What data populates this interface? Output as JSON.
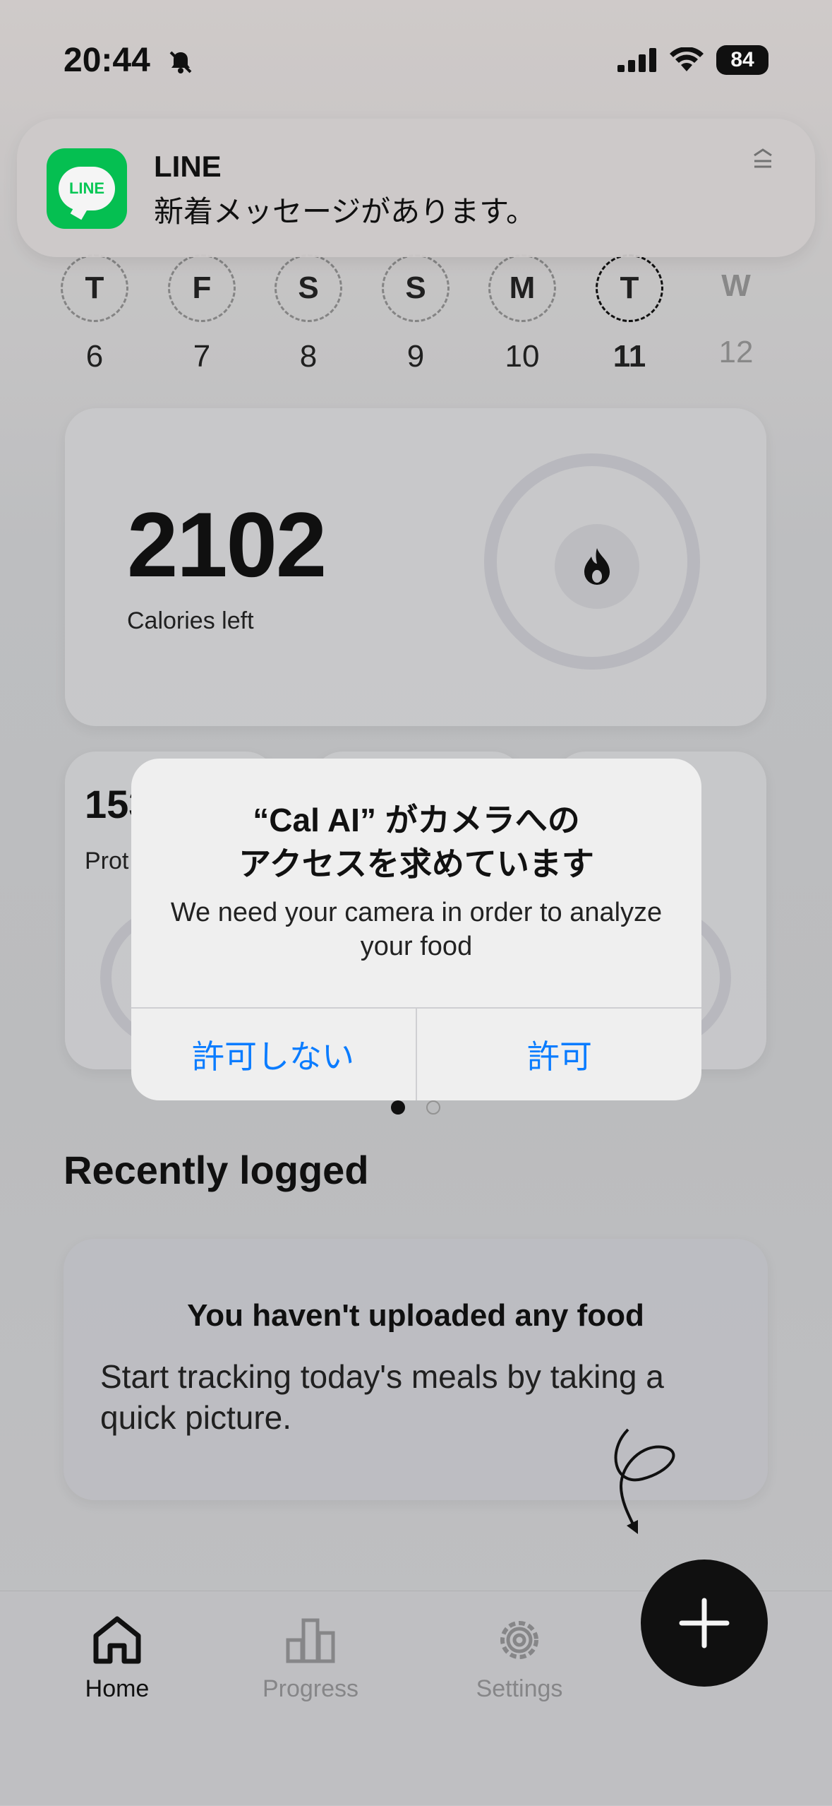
{
  "status_bar": {
    "time": "20:44",
    "battery": "84",
    "icons": [
      "bell-slash-icon",
      "signal-icon",
      "wifi-icon",
      "battery-icon"
    ]
  },
  "notification": {
    "app": "LINE",
    "icon_text": "LINE",
    "message": "新着メッセージがあります。"
  },
  "week": [
    {
      "letter": "T",
      "date": "6"
    },
    {
      "letter": "F",
      "date": "7"
    },
    {
      "letter": "S",
      "date": "8"
    },
    {
      "letter": "S",
      "date": "9"
    },
    {
      "letter": "M",
      "date": "10"
    },
    {
      "letter": "T",
      "date": "11",
      "active": true
    },
    {
      "letter": "W",
      "date": "12",
      "future": true
    }
  ],
  "calories": {
    "value": "2102",
    "label": "Calories left"
  },
  "macros": [
    {
      "value": "153",
      "label": "Prot"
    }
  ],
  "recent": {
    "title": "Recently logged",
    "empty_title": "You haven't uploaded any food",
    "empty_body": "Start tracking today's meals by taking a quick picture."
  },
  "tabs": {
    "home": "Home",
    "progress": "Progress",
    "settings": "Settings"
  },
  "alert": {
    "title_line1": "“Cal AI” がカメラへの",
    "title_line2": "アクセスを求めています",
    "message": "We need your camera in order to analyze your food",
    "deny": "許可しない",
    "allow": "許可"
  },
  "colors": {
    "accent": "#0a7cff",
    "line_green": "#06c755"
  }
}
